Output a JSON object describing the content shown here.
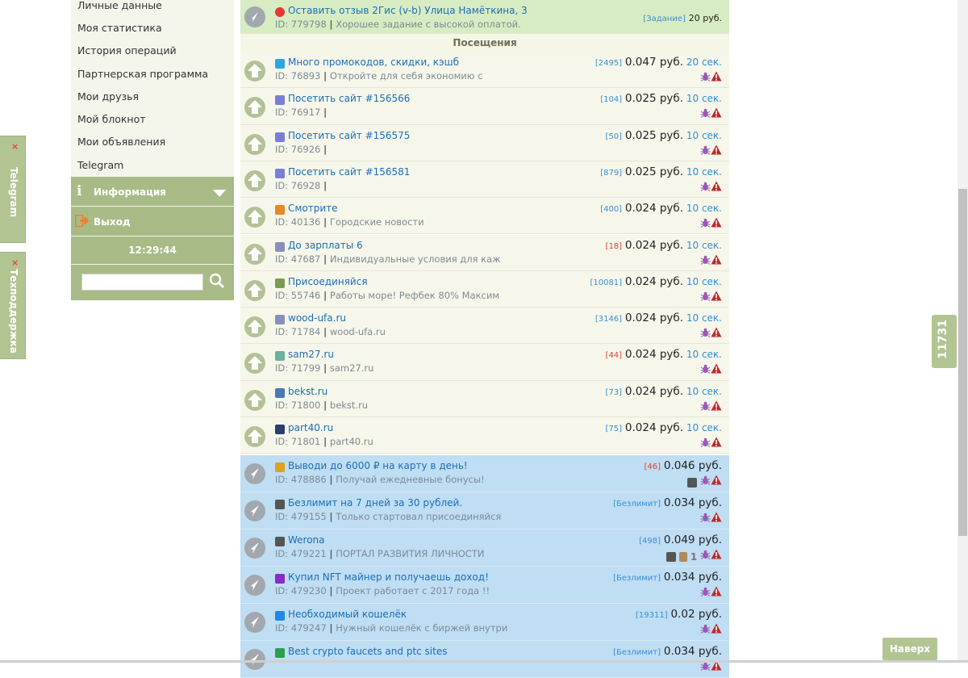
{
  "tabs": {
    "telegram": "Telegram",
    "support": "Техподдержка",
    "close": "×"
  },
  "sidebar": {
    "items": [
      "Личные данные",
      "Моя статистика",
      "История операций",
      "Партнерская программа",
      "Мои друзья",
      "Мой блокнот",
      "Мои объявления",
      "Telegram"
    ],
    "info_label": "Информация",
    "exit_label": "Выход",
    "clock": "12:29:44",
    "search_value": ""
  },
  "main": {
    "top": {
      "title": "Оставить отзыв 2Гис (v-b) Улица Намёткина, 3",
      "id": "ID: 779798",
      "desc": "Хорошее задание с высокой оплатой.",
      "tag": "[Задание]",
      "price": "20 руб."
    },
    "section_title": "Посещения",
    "visits": [
      {
        "title": "Много промокодов, скидки, кэшб",
        "id": "ID: 76893",
        "desc": "Откройте для себя экономию с",
        "cnt": "[2495]",
        "price": "0.047 руб.",
        "sec": "20 сек.",
        "fav": "telegram-icon",
        "fav_color": "#2ca5e0"
      },
      {
        "title": "Посетить сайт #156566",
        "id": "ID: 76917",
        "desc": "",
        "cnt": "[104]",
        "price": "0.025 руб.",
        "sec": "10 сек.",
        "fav": "link-icon",
        "fav_color": "#7a7fd6"
      },
      {
        "title": "Посетить сайт #156575",
        "id": "ID: 76926",
        "desc": "",
        "cnt": "[50]",
        "price": "0.025 руб.",
        "sec": "10 сек.",
        "fav": "link-icon",
        "fav_color": "#7a7fd6"
      },
      {
        "title": "Посетить сайт #156581",
        "id": "ID: 76928",
        "desc": "",
        "cnt": "[879]",
        "price": "0.025 руб.",
        "sec": "10 сек.",
        "fav": "link-icon",
        "fav_color": "#7a7fd6"
      },
      {
        "title": "Смотрите",
        "id": "ID: 40136",
        "desc": "Городские новости",
        "cnt": "[400]",
        "price": "0.024 руб.",
        "sec": "10 сек.",
        "fav": "news-icon",
        "fav_color": "#e8862a"
      },
      {
        "title": "До зарплаты 6",
        "id": "ID: 47687",
        "desc": "Индивидуальные условия для каж",
        "cnt": "[18]",
        "cnt_red": true,
        "price": "0.024 руб.",
        "sec": "10 сек.",
        "fav": "globe-icon",
        "fav_color": "#8a8fb8"
      },
      {
        "title": "Присоединяйся",
        "id": "ID: 55746",
        "desc": "Работы море! Рефбек 80% Максим",
        "cnt": "[10081]",
        "price": "0.024 руб.",
        "sec": "10 сек.",
        "fav": "sf-icon",
        "fav_color": "#7c9a54"
      },
      {
        "title": "wood-ufa.ru",
        "id": "ID: 71784",
        "desc": "wood-ufa.ru",
        "cnt": "[3146]",
        "price": "0.024 руб.",
        "sec": "10 сек.",
        "fav": "globe-icon",
        "fav_color": "#8a8fb8"
      },
      {
        "title": "sam27.ru",
        "id": "ID: 71799",
        "desc": "sam27.ru",
        "cnt": "[44]",
        "cnt_red": true,
        "price": "0.024 руб.",
        "sec": "10 сек.",
        "fav": "home-icon",
        "fav_color": "#6bb0a0"
      },
      {
        "title": "bekst.ru",
        "id": "ID: 71800",
        "desc": "bekst.ru",
        "cnt": "[73]",
        "price": "0.024 руб.",
        "sec": "10 сек.",
        "fav": "tools-icon",
        "fav_color": "#4a78b8"
      },
      {
        "title": "part40.ru",
        "id": "ID: 71801",
        "desc": "part40.ru",
        "cnt": "[75]",
        "price": "0.024 руб.",
        "sec": "10 сек.",
        "fav": "car-icon",
        "fav_color": "#2c3e6a"
      }
    ],
    "ads": [
      {
        "title": "Выводи до 6000 ₽ на карту в день!",
        "id": "ID: 478886",
        "desc": "Получай ежедневные бонусы!",
        "cnt": "[46]",
        "cnt_red": true,
        "price": "0.046 руб.",
        "extra": "copy",
        "fav": "face-icon",
        "fav_color": "#e0a020"
      },
      {
        "title": "Безлимит на 7 дней за 30 рублей.",
        "id": "ID: 479155",
        "desc": "Только стартовал присоединяйся",
        "cnt": "[Безлимит]",
        "price": "0.034 руб.",
        "extra": "",
        "fav": "search-icon",
        "fav_color": "#555555"
      },
      {
        "title": "Werona",
        "id": "ID: 479221",
        "desc": "ПОРТАЛ РАЗВИТИЯ ЛИЧНОСТИ",
        "cnt": "[498]",
        "price": "0.049 руб.",
        "extra": "copy-brown-one",
        "one": "1",
        "fav": "wordpress-icon",
        "fav_color": "#555555"
      },
      {
        "title": "Купил NFT майнер и получаешь доход!",
        "id": "ID: 479230",
        "desc": "Проект работает с 2017 года !!",
        "cnt": "[Безлимит]",
        "price": "0.034 руб.",
        "extra": "",
        "fav": "coin-icon",
        "fav_color": "#8a2cc8"
      },
      {
        "title": "Необходимый кошелёк",
        "id": "ID: 479247",
        "desc": "Нужный кошелёк с биржей внутри",
        "cnt": "[19311]",
        "price": "0.02 руб.",
        "extra": "",
        "fav": "p-icon",
        "fav_color": "#1e88e5"
      },
      {
        "title": "Best crypto faucets and ptc sites",
        "id": "",
        "desc": "",
        "cnt": "[Безлимит]",
        "price": "0.034 руб.",
        "extra": "",
        "fav": "dollar-icon",
        "fav_color": "#2e9e4e"
      }
    ]
  },
  "counter": "11731",
  "top_button": "Наверх",
  "colors": {
    "green_panel": "#a8bb86",
    "link": "#1b6eb8",
    "blue_row": "#bfddf3",
    "green_row": "#f6f7ea"
  }
}
